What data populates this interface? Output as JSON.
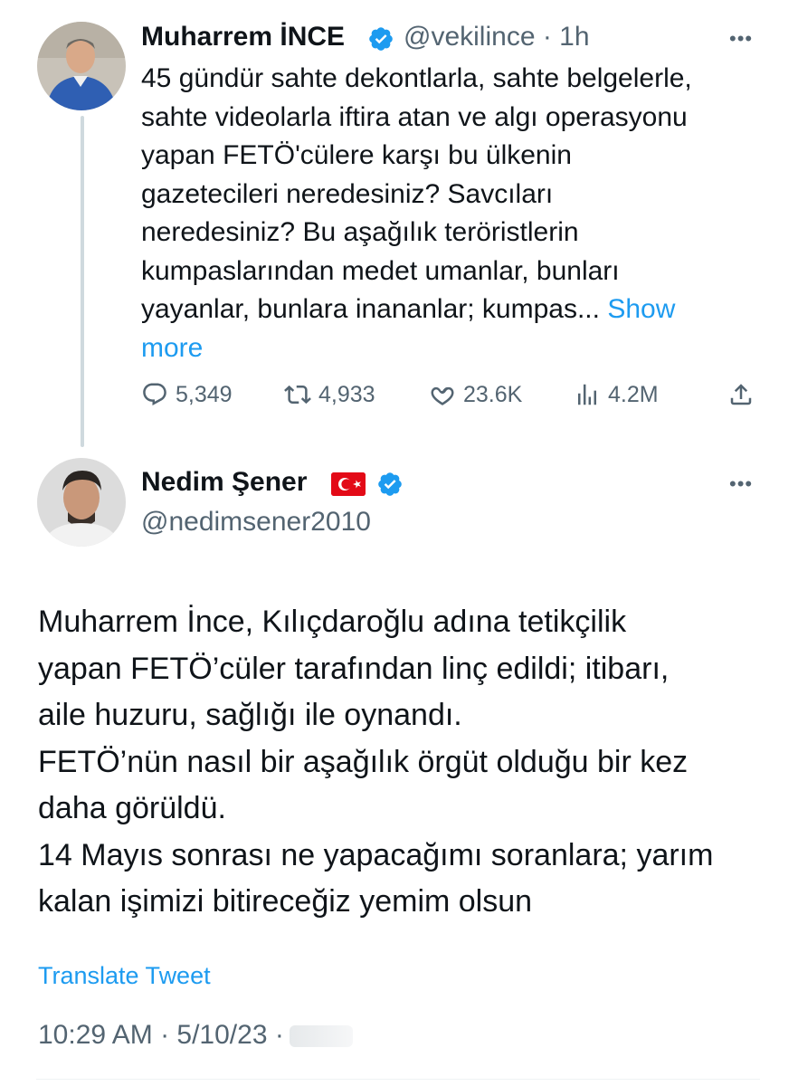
{
  "tweet1": {
    "author_name": "Muharrem İNCE",
    "handle_time": "@vekilince · 1h",
    "lines": [
      "45 gündür sahte dekontlarla, sahte belgelerle,",
      "sahte videolarla iftira atan ve algı operasyonu",
      "yapan FETÖ'cülere karşı bu ülkenin",
      "gazetecileri neredesiniz? Savcıları",
      "neredesiniz? Bu aşağılık teröristlerin",
      "kumpaslarından medet umanlar, bunları",
      "yayanlar, bunlara inananlar; kumpas..."
    ],
    "show_more_1": "Show",
    "show_more_2": "more",
    "replies": "5,349",
    "retweets": "4,933",
    "likes": "23.6K",
    "views": "4.2M"
  },
  "tweet2": {
    "author_name": "Nedim Şener",
    "handle": "@nedimsener2010",
    "lines": [
      "Muharrem İnce, Kılıçdaroğlu adına tetikçilik",
      "yapan FETÖ’cüler tarafından linç edildi; itibarı,",
      "aile huzuru, sağlığı ile oynandı.",
      "FETÖ’nün nasıl bir aşağılık örgüt olduğu bir kez",
      "daha görüldü.",
      "14 Mayıs sonrası ne yapacağımı soranlara; yarım",
      "kalan işimizi bitireceğiz yemim olsun"
    ],
    "translate": "Translate Tweet",
    "timestamp": "10:29 AM · 5/10/23 ·"
  },
  "colors": {
    "accent": "#1d9bf0",
    "secondary_text": "#536471",
    "flag_red": "#e30a17"
  },
  "icons": [
    "verified-badge-icon",
    "reply-icon",
    "retweet-icon",
    "like-icon",
    "views-icon",
    "share-icon",
    "more-icon",
    "turkey-flag-icon"
  ]
}
